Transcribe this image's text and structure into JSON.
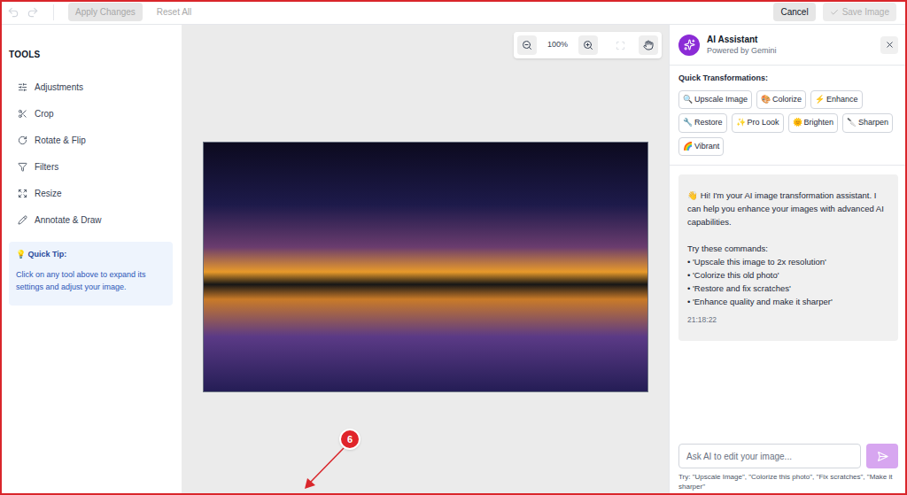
{
  "toolbar": {
    "undo": {
      "disabled": true
    },
    "redo": {
      "disabled": true
    },
    "left_buttons": [
      {
        "label": "Apply Changes",
        "disabled": true
      },
      {
        "label": "Reset All",
        "disabled": true
      }
    ],
    "right_buttons": [
      {
        "label": "Cancel",
        "disabled": false
      },
      {
        "label": "Save Image",
        "disabled": true
      }
    ]
  },
  "sidebar": {
    "title": "TOOLS",
    "items": [
      {
        "label": "Adjustments"
      },
      {
        "label": "Crop"
      },
      {
        "label": "Rotate & Flip"
      },
      {
        "label": "Filters"
      },
      {
        "label": "Resize"
      },
      {
        "label": "Annotate & Draw"
      }
    ],
    "tip": {
      "icon": "💡",
      "title": "Quick Tip:",
      "text": "Click on any tool above to expand its settings and adjust your image."
    }
  },
  "canvas": {
    "zoom": "100%"
  },
  "assistant": {
    "title": "AI Assistant",
    "subtitle": "Powered by Gemini",
    "quick_title": "Quick Transformations:",
    "chips": [
      {
        "icon": "🔍",
        "label": "Upscale Image"
      },
      {
        "icon": "🎨",
        "label": "Colorize"
      },
      {
        "icon": "⚡",
        "label": "Enhance"
      },
      {
        "icon": "🔧",
        "label": "Restore"
      },
      {
        "icon": "✨",
        "label": "Pro Look"
      },
      {
        "icon": "🌞",
        "label": "Brighten"
      },
      {
        "icon": "🔪",
        "label": "Sharpen"
      },
      {
        "icon": "🌈",
        "label": "Vibrant"
      }
    ],
    "message": {
      "greeting": "👋 Hi! I'm your AI image transformation assistant. I can help you enhance your images with advanced AI capabilities.",
      "prompt": "Try these commands:",
      "commands": [
        "• 'Upscale this image to 2x resolution'",
        "• 'Colorize this old photo'",
        "• 'Restore and fix scratches'",
        "• 'Enhance quality and make it sharper'"
      ],
      "time": "21:18:22"
    },
    "input": {
      "placeholder": "Ask AI to edit your image...",
      "hint": "Try: \"Upscale Image\", \"Colorize this photo\", \"Fix scratches\", \"Make it sharper\""
    }
  },
  "annotation": {
    "label": "6"
  }
}
